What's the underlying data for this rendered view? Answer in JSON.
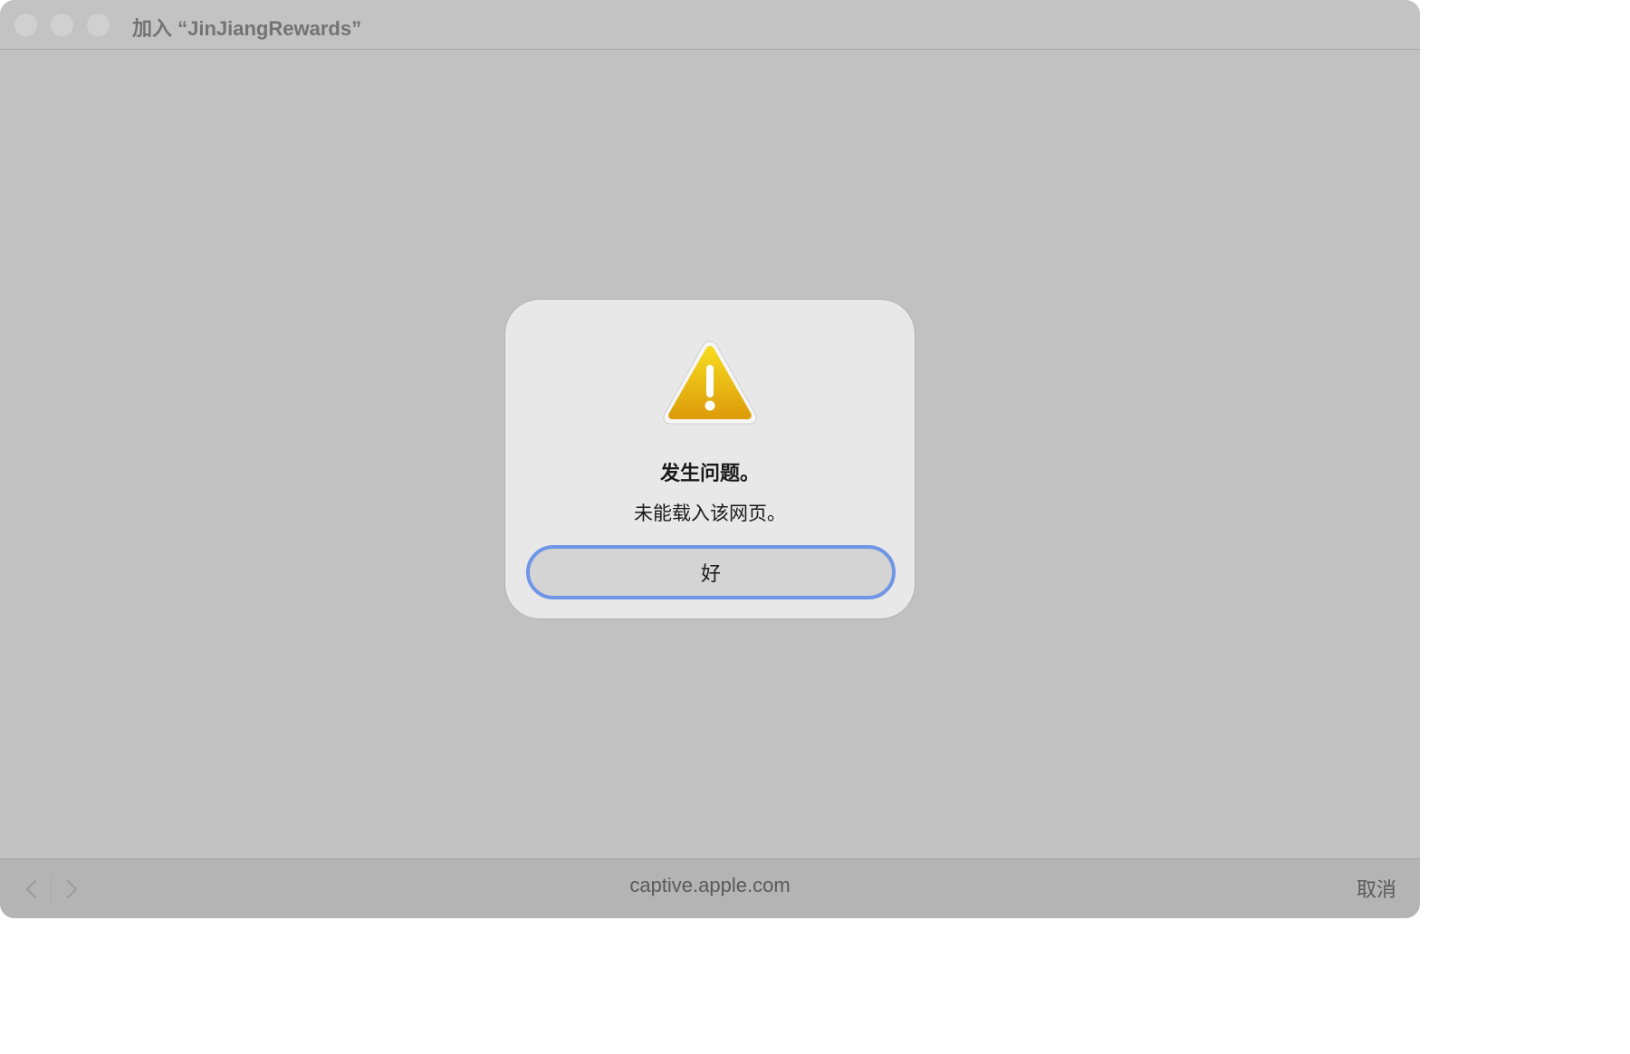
{
  "window": {
    "title": "加入 “JinJiangRewards”"
  },
  "dialog": {
    "icon": "warning-icon",
    "title": "发生问题。",
    "message": "未能载入该网页。",
    "ok_label": "好",
    "colors": {
      "focus_ring": "#6f96e6",
      "warning_yellow": "#f2c418",
      "warning_orange": "#e0a10c"
    }
  },
  "bottombar": {
    "back_icon": "chevron-left-icon",
    "forward_icon": "chevron-right-icon",
    "url": "captive.apple.com",
    "cancel_label": "取消"
  }
}
